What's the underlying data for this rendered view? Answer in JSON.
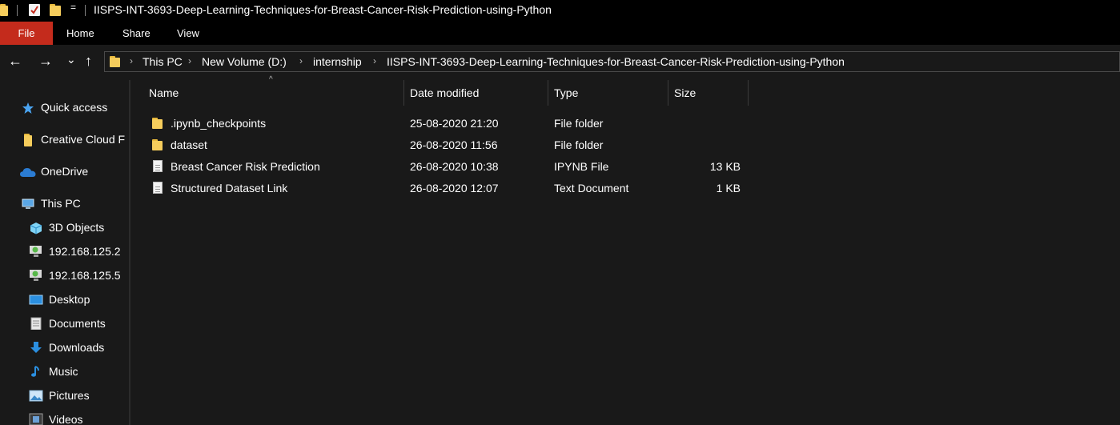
{
  "window": {
    "title": "IISPS-INT-3693-Deep-Learning-Techniques-for-Breast-Cancer-Risk-Prediction-using-Python",
    "qa_dropdown_glyph": "=",
    "accent_color": "#c42b1c"
  },
  "ribbon": {
    "tabs": [
      "File",
      "Home",
      "Share",
      "View"
    ]
  },
  "nav": {
    "back": "←",
    "forward": "→",
    "recent": "⌄",
    "up": "↑"
  },
  "breadcrumb": {
    "items": [
      "This PC",
      "New Volume (D:)",
      "internship",
      "IISPS-INT-3693-Deep-Learning-Techniques-for-Breast-Cancer-Risk-Prediction-using-Python"
    ],
    "separator": "›"
  },
  "sidebar": {
    "items": [
      {
        "label": "Quick access",
        "icon": "star-icon"
      },
      {
        "label": "Creative Cloud F",
        "icon": "folder-icon"
      },
      {
        "label": "OneDrive",
        "icon": "cloud-icon"
      },
      {
        "label": "This PC",
        "icon": "computer-icon"
      },
      {
        "label": "3D Objects",
        "icon": "cube-icon"
      },
      {
        "label": "192.168.125.2",
        "icon": "network-drive-icon"
      },
      {
        "label": "192.168.125.5",
        "icon": "network-drive-icon"
      },
      {
        "label": "Desktop",
        "icon": "desktop-icon"
      },
      {
        "label": "Documents",
        "icon": "documents-icon"
      },
      {
        "label": "Downloads",
        "icon": "downloads-icon"
      },
      {
        "label": "Music",
        "icon": "music-icon"
      },
      {
        "label": "Pictures",
        "icon": "pictures-icon"
      },
      {
        "label": "Videos",
        "icon": "videos-icon"
      }
    ]
  },
  "columns": {
    "name": "Name",
    "date": "Date modified",
    "type": "Type",
    "size": "Size",
    "sort_glyph": "^"
  },
  "files": [
    {
      "name": ".ipynb_checkpoints",
      "date": "25-08-2020 21:20",
      "type": "File folder",
      "size": "",
      "icon": "folder-icon"
    },
    {
      "name": "dataset",
      "date": "26-08-2020 11:56",
      "type": "File folder",
      "size": "",
      "icon": "folder-icon"
    },
    {
      "name": "Breast Cancer Risk Prediction",
      "date": "26-08-2020 10:38",
      "type": "IPYNB File",
      "size": "13 KB",
      "icon": "file-icon"
    },
    {
      "name": "Structured Dataset Link",
      "date": "26-08-2020 12:07",
      "type": "Text Document",
      "size": "1 KB",
      "icon": "text-file-icon"
    }
  ]
}
